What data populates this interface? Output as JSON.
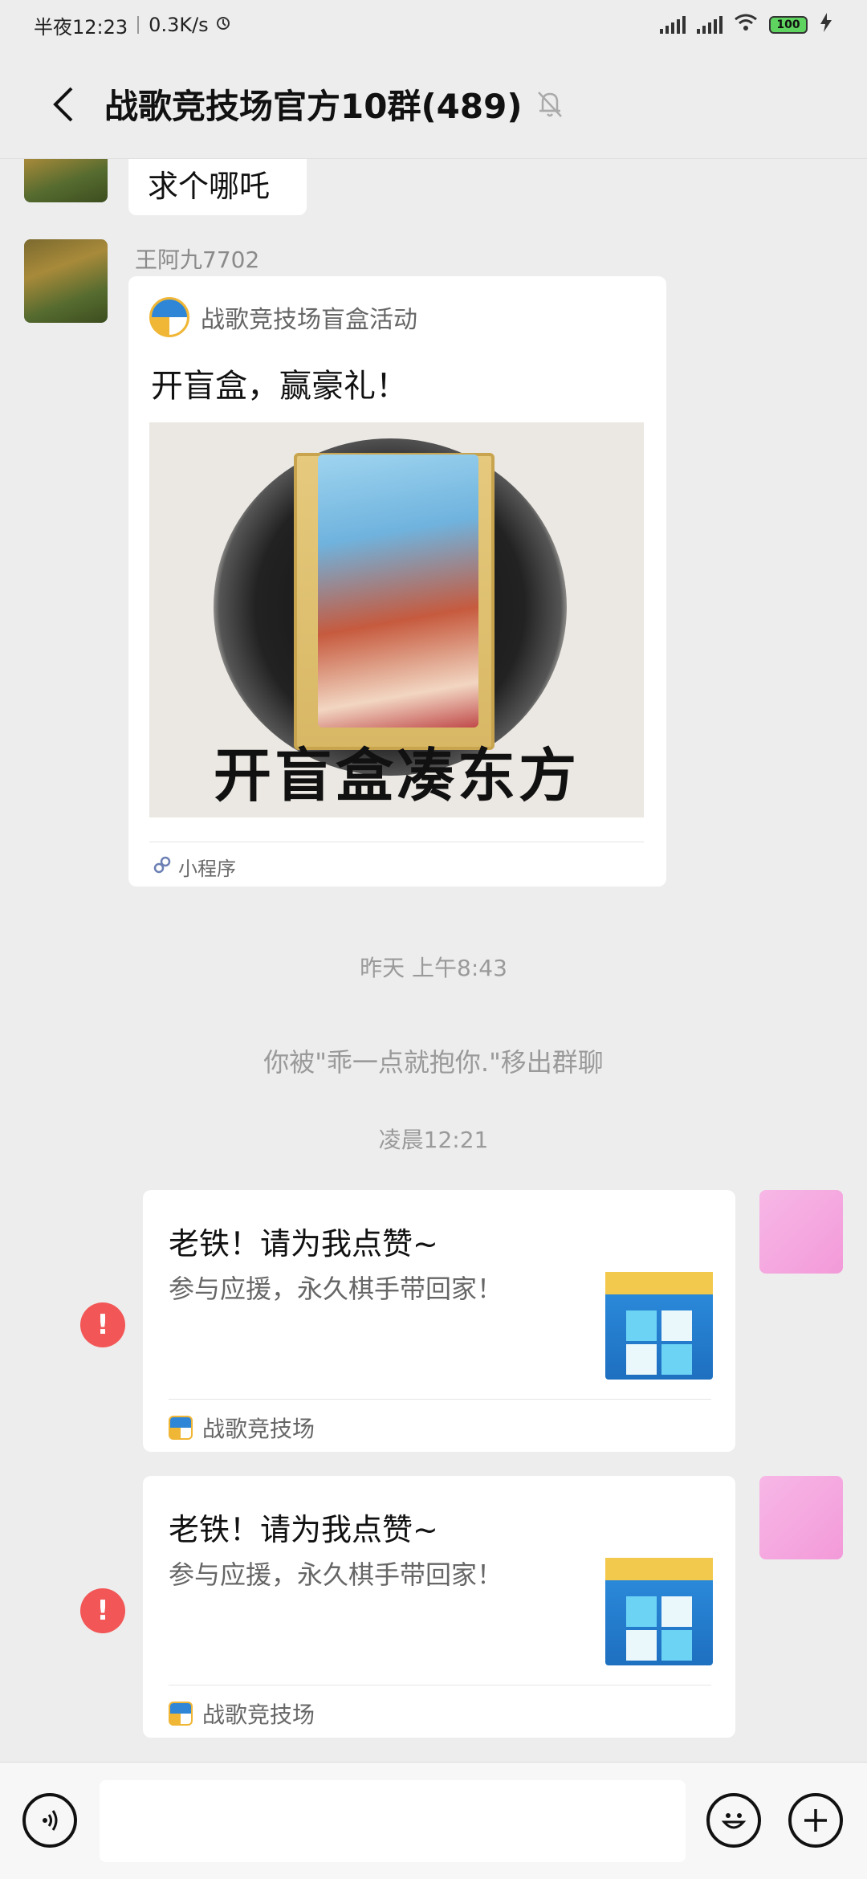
{
  "status": {
    "time": "半夜12:23",
    "speed": "0.3K/s",
    "battery": "100"
  },
  "header": {
    "title": "战歌竞技场官方10群(489)"
  },
  "messages": {
    "first": {
      "text": "求个哪吒"
    },
    "card": {
      "sender": "王阿九7702",
      "source": "战歌竞技场盲盒活动",
      "title": "开盲盒，赢豪礼！",
      "cover_caption": "开盲盒凑东方",
      "footer": "小程序"
    },
    "timestamp1": "昨天 上午8:43",
    "system_notice": "你被\"乖一点就抱你.\"移出群聊",
    "timestamp2": "凌晨12:21",
    "share1": {
      "title": "老铁！请为我点赞~",
      "desc": "参与应援，永久棋手带回家！",
      "source": "战歌竞技场",
      "error": "!"
    },
    "share2": {
      "title": "老铁！请为我点赞~",
      "desc": "参与应援，永久棋手带回家！",
      "source": "战歌竞技场",
      "error": "!"
    }
  },
  "input": {
    "placeholder": ""
  },
  "icons": [
    "back-icon",
    "mute-bell-icon",
    "voice-icon",
    "emoji-icon",
    "plus-icon",
    "error-icon",
    "mini-program-icon"
  ]
}
